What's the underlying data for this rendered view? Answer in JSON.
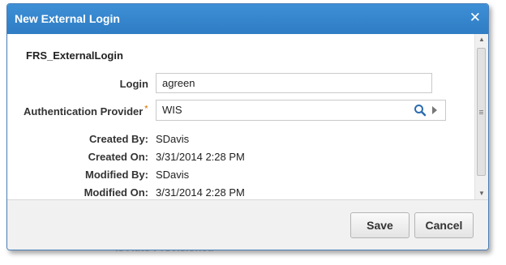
{
  "backdrop": {
    "text": "Is Auto Provisioned"
  },
  "dialog": {
    "title": "New External Login",
    "close_glyph": "✕",
    "section_title": "FRS_ExternalLogin",
    "fields": {
      "login": {
        "label": "Login",
        "value": "agreen"
      },
      "provider": {
        "label": "Authentication Provider",
        "required_marker": "*",
        "value": "WIS"
      },
      "created_by": {
        "label": "Created By:",
        "value": "SDavis"
      },
      "created_on": {
        "label": "Created On:",
        "value": "3/31/2014 2:28 PM"
      },
      "modified_by": {
        "label": "Modified By:",
        "value": "SDavis"
      },
      "modified_on": {
        "label": "Modified On:",
        "value": "3/31/2014 2:28 PM"
      }
    },
    "buttons": {
      "save": "Save",
      "cancel": "Cancel"
    }
  },
  "icons": {
    "search": "search-icon",
    "arrow": "play-arrow-icon",
    "close": "close-icon"
  },
  "colors": {
    "titlebar": "#3a8ad1",
    "accent_search": "#2b6cb0",
    "required": "#e08a2a"
  }
}
